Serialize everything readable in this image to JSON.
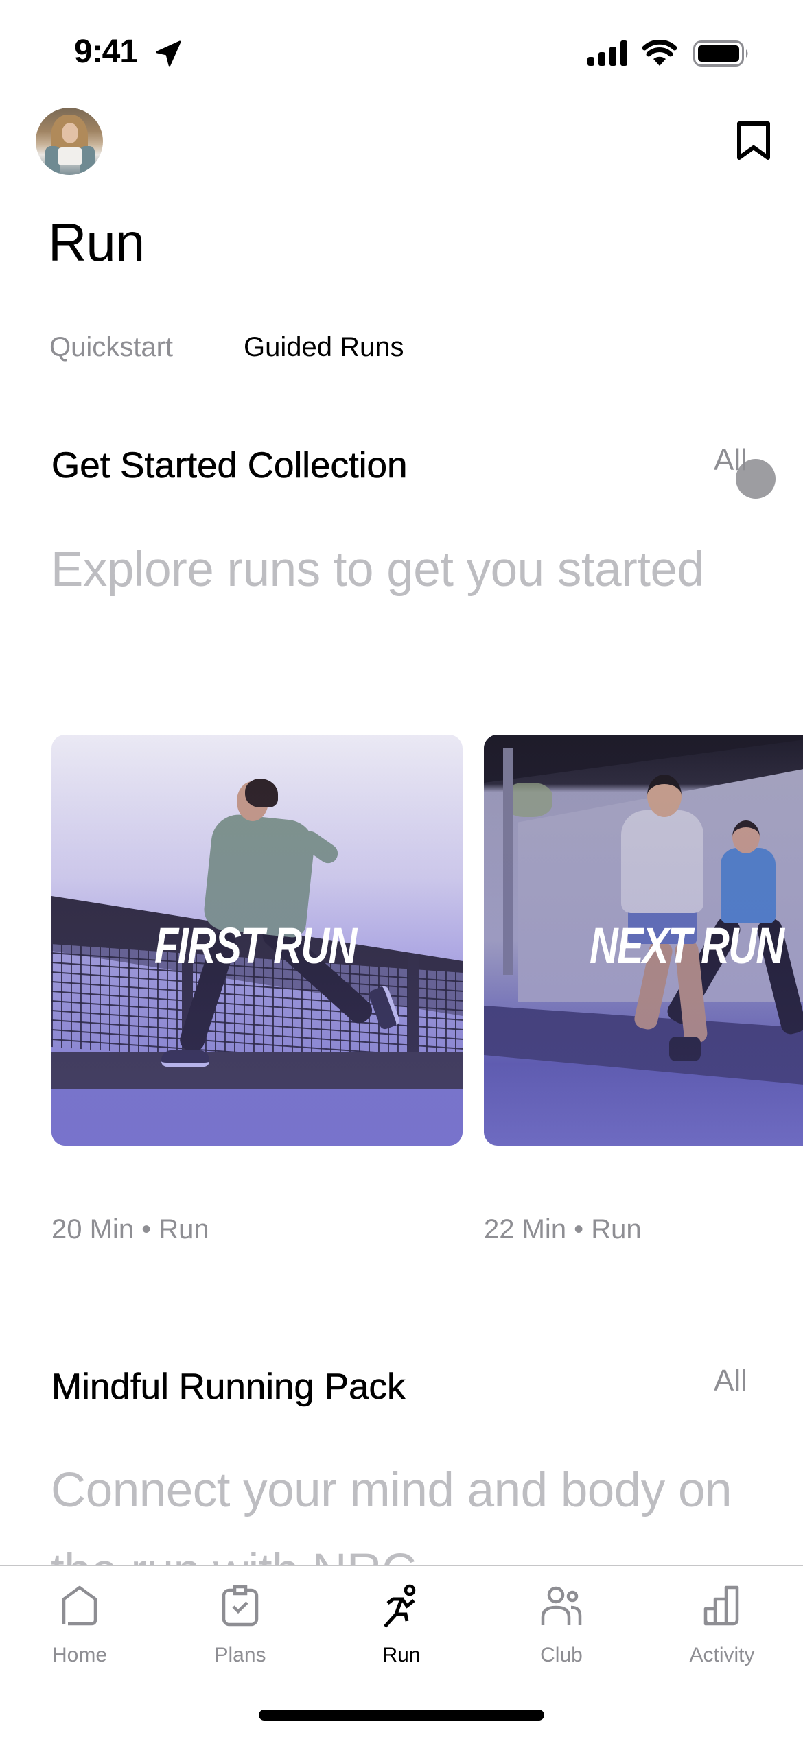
{
  "status_bar": {
    "time": "9:41",
    "icons": [
      "location-arrow-icon",
      "cellular-signal-icon",
      "wifi-icon",
      "battery-icon"
    ]
  },
  "header": {
    "avatar": "user-avatar",
    "bookmark_icon": "bookmark-icon",
    "title": "Run"
  },
  "segments": [
    {
      "label": "Quickstart",
      "selected": false
    },
    {
      "label": "Guided Runs",
      "selected": true
    }
  ],
  "sections": [
    {
      "title": "Get Started Collection",
      "all_label": "All",
      "subtitle": "Explore runs to get you started",
      "cards": [
        {
          "overlay_title": "FIRST RUN",
          "meta": "20 Min • Run"
        },
        {
          "overlay_title": "NEXT RUN",
          "meta": "22 Min • Run"
        }
      ]
    },
    {
      "title": "Mindful Running Pack",
      "all_label": "All",
      "subtitle": "Connect your mind and body on the run with NRC"
    }
  ],
  "tab_bar": {
    "items": [
      {
        "label": "Home",
        "icon": "home-icon",
        "active": false
      },
      {
        "label": "Plans",
        "icon": "clipboard-check-icon",
        "active": false
      },
      {
        "label": "Run",
        "icon": "runner-icon",
        "active": true
      },
      {
        "label": "Club",
        "icon": "people-icon",
        "active": false
      },
      {
        "label": "Activity",
        "icon": "bar-chart-icon",
        "active": false
      }
    ]
  },
  "colors": {
    "primary_text": "#000000",
    "secondary_text": "#8e8e93",
    "subtitle_text": "#bdbdc1",
    "card_tint": "#7b78c6"
  }
}
